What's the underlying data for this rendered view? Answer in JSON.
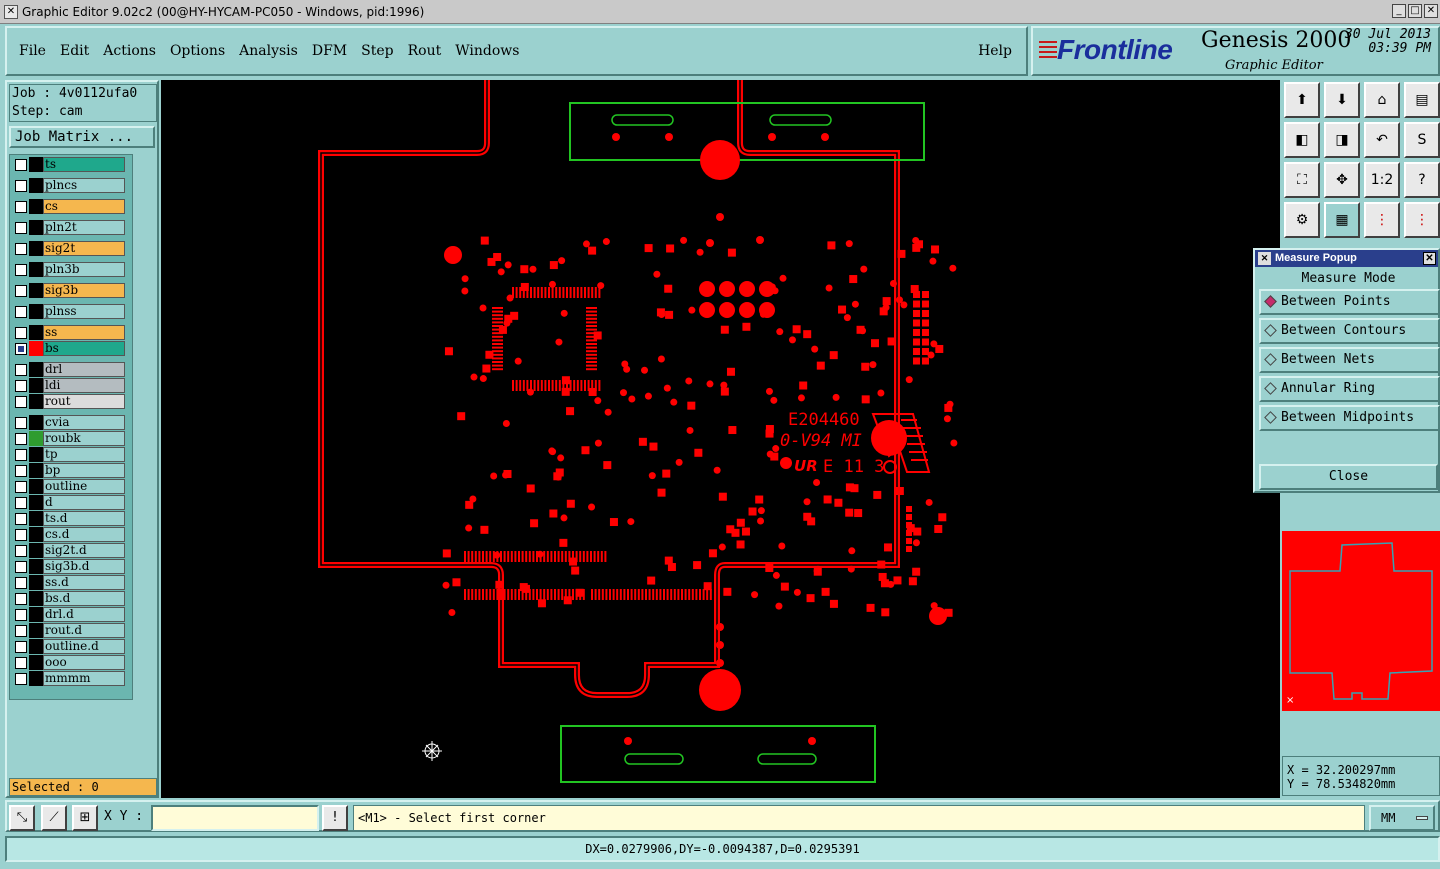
{
  "window": {
    "title": "Graphic Editor 9.02c2 (00@HY-HYCAM-PC050 - Windows, pid:1996)"
  },
  "menu": {
    "items": [
      "File",
      "Edit",
      "Actions",
      "Options",
      "Analysis",
      "DFM",
      "Step",
      "Rout",
      "Windows"
    ],
    "help": "Help"
  },
  "brand": {
    "logo": "Frontline",
    "product": "Genesis 2000",
    "subtitle": "Graphic Editor",
    "date": "30 Jul 2013",
    "time": "03:39 PM"
  },
  "job": {
    "job_line": "Job : 4v0112ufa0",
    "step_line": "Step: cam",
    "matrix_button": "Job Matrix ..."
  },
  "layers": [
    {
      "name": "ts",
      "color": "#1fa88c",
      "marker": "#000000",
      "checked": false
    },
    {
      "name": "plncs",
      "color": "#9bd1cf",
      "marker": "#000000",
      "checked": false
    },
    {
      "name": "cs",
      "color": "#f5b74e",
      "marker": "#000000",
      "checked": false
    },
    {
      "name": "pln2t",
      "color": "#9bd1cf",
      "marker": "#000000",
      "checked": false
    },
    {
      "name": "sig2t",
      "color": "#f5b74e",
      "marker": "#000000",
      "checked": false
    },
    {
      "name": "pln3b",
      "color": "#9bd1cf",
      "marker": "#000000",
      "checked": false
    },
    {
      "name": "sig3b",
      "color": "#f5b74e",
      "marker": "#000000",
      "checked": false
    },
    {
      "name": "plnss",
      "color": "#9bd1cf",
      "marker": "#000000",
      "checked": false
    },
    {
      "name": "ss",
      "color": "#f5b74e",
      "marker": "#000000",
      "checked": false
    },
    {
      "name": "bs",
      "color": "#1fa88c",
      "marker": "#ff0000",
      "checked": true
    },
    {
      "name": "drl",
      "color": "#b4bcc0",
      "marker": "#000000",
      "checked": false
    },
    {
      "name": "ldi",
      "color": "#b4bcc0",
      "marker": "#000000",
      "checked": false
    },
    {
      "name": "rout",
      "color": "#dcdcdc",
      "marker": "#000000",
      "checked": false
    },
    {
      "name": "cvia",
      "color": "#9bd1cf",
      "marker": "#000000",
      "checked": false
    },
    {
      "name": "roubk",
      "color": "#9bd1cf",
      "marker": "#2f9c2f",
      "checked": false
    },
    {
      "name": "tp",
      "color": "#9bd1cf",
      "marker": "#000000",
      "checked": false
    },
    {
      "name": "bp",
      "color": "#9bd1cf",
      "marker": "#000000",
      "checked": false
    },
    {
      "name": "outline",
      "color": "#9bd1cf",
      "marker": "#000000",
      "checked": false
    },
    {
      "name": "d",
      "color": "#9bd1cf",
      "marker": "#000000",
      "checked": false
    },
    {
      "name": "ts.d",
      "color": "#9bd1cf",
      "marker": "#000000",
      "checked": false
    },
    {
      "name": "cs.d",
      "color": "#9bd1cf",
      "marker": "#000000",
      "checked": false
    },
    {
      "name": "sig2t.d",
      "color": "#9bd1cf",
      "marker": "#000000",
      "checked": false
    },
    {
      "name": "sig3b.d",
      "color": "#9bd1cf",
      "marker": "#000000",
      "checked": false
    },
    {
      "name": "ss.d",
      "color": "#9bd1cf",
      "marker": "#000000",
      "checked": false
    },
    {
      "name": "bs.d",
      "color": "#9bd1cf",
      "marker": "#000000",
      "checked": false
    },
    {
      "name": "drl.d",
      "color": "#9bd1cf",
      "marker": "#000000",
      "checked": false
    },
    {
      "name": "rout.d",
      "color": "#9bd1cf",
      "marker": "#000000",
      "checked": false
    },
    {
      "name": "outline.d",
      "color": "#9bd1cf",
      "marker": "#000000",
      "checked": false
    },
    {
      "name": "ooo",
      "color": "#9bd1cf",
      "marker": "#000000",
      "checked": false
    },
    {
      "name": "mmmm",
      "color": "#9bd1cf",
      "marker": "#000000",
      "checked": false
    }
  ],
  "selected": "Selected : 0",
  "board_text": {
    "line1": "E204460",
    "line2": "0-V94 MI",
    "line3": "E 11 3"
  },
  "tools": [
    "upload-icon",
    "download-icon",
    "home-icon",
    "split-view-icon",
    "left-step-icon",
    "right-step-icon",
    "undo-icon",
    "snake-icon",
    "fit-icon",
    "zoom-fit-icon",
    "one-to-one-icon",
    "help-icon",
    "settings-icon",
    "grid-icon",
    "nets-icon",
    "nets-alt-icon"
  ],
  "tool_labels": {
    "one_to_one": "1:2",
    "help": "?"
  },
  "measure_popup": {
    "title": "Measure Popup",
    "mode_label": "Measure Mode",
    "options": [
      {
        "label": "Between Points",
        "selected": true
      },
      {
        "label": "Between Contours",
        "selected": false
      },
      {
        "label": "Between Nets",
        "selected": false
      },
      {
        "label": "Annular Ring",
        "selected": false
      },
      {
        "label": "Between Midpoints",
        "selected": false
      }
    ],
    "close": "Close"
  },
  "coords": {
    "x": "X  =  32.200297mm",
    "y": "Y  =  78.534820mm"
  },
  "bottom": {
    "xy_label": "X Y :",
    "xy_value": "",
    "prompt": "<M1> - Select first corner",
    "unit": "MM"
  },
  "status": "DX=0.0279906,DY=-0.0094387,D=0.0295391"
}
